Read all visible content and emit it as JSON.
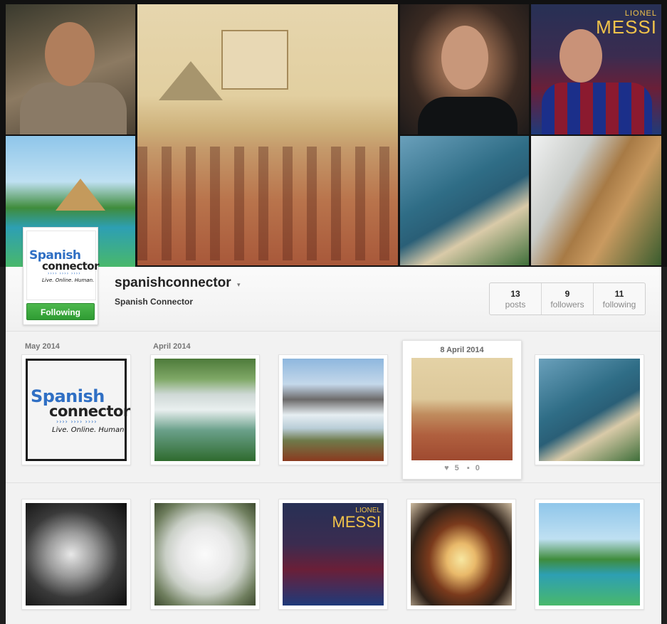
{
  "banner": {
    "tiles": [
      {
        "name": "portrait-man-scarf"
      },
      {
        "name": "mayan-illustration"
      },
      {
        "name": "portrait-man-long-hair"
      },
      {
        "name": "messi-poster",
        "text_small": "LIONEL",
        "text_big": "MESSI"
      },
      {
        "name": "tropical-resort"
      },
      {
        "name": "beach-coastline"
      },
      {
        "name": "waterfall-cliff"
      }
    ]
  },
  "profile": {
    "username": "spanishconnector",
    "username_caret": "▾",
    "full_name": "Spanish Connector",
    "follow_label": "Following",
    "logo": {
      "line1": "Spanish",
      "line2": "connector",
      "waves": "›››› ›››› ››››",
      "tagline": "Live. Online. Human."
    }
  },
  "stats": [
    {
      "value": "13",
      "label": "posts"
    },
    {
      "value": "9",
      "label": "followers"
    },
    {
      "value": "11",
      "label": "following"
    }
  ],
  "feed": {
    "row1_dates": [
      "May 2014",
      "April 2014"
    ],
    "featured": {
      "date": "8 April 2014",
      "likes": "5",
      "comments": "0",
      "like_icon": "heart-icon",
      "comment_icon": "comment-icon"
    },
    "posts": [
      {
        "name": "post-spanish-connector-logo"
      },
      {
        "name": "post-waterfall"
      },
      {
        "name": "post-glacier"
      },
      {
        "name": "post-mayan-illustration"
      },
      {
        "name": "post-beach"
      },
      {
        "name": "post-portrait-old-man"
      },
      {
        "name": "post-white-orchid"
      },
      {
        "name": "post-messi",
        "text_small": "LIONEL",
        "text_big": "MESSI"
      },
      {
        "name": "post-food-plate"
      },
      {
        "name": "post-resort"
      }
    ]
  },
  "colors": {
    "follow_green": "#3aa83d",
    "logo_blue": "#2f6fc4",
    "panel_bg": "#f2f2f2"
  }
}
